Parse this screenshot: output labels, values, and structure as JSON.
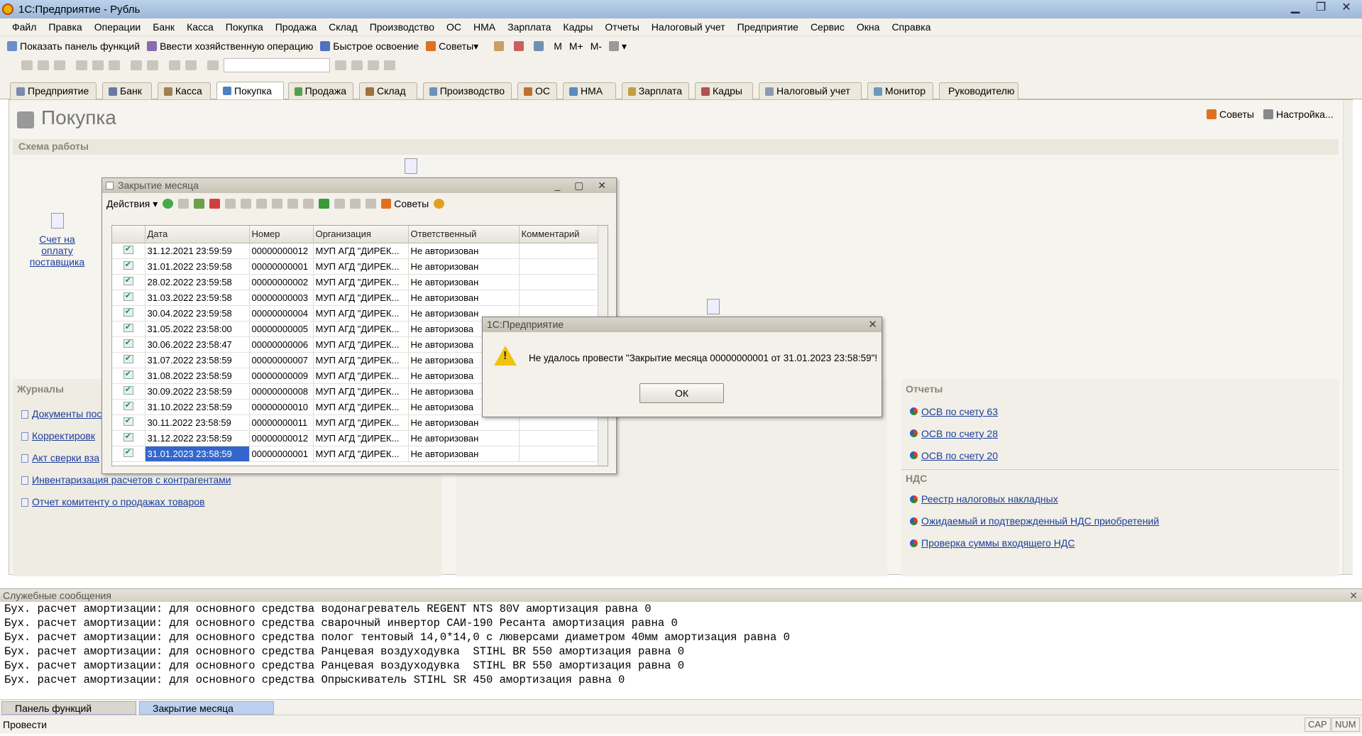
{
  "window": {
    "title": "1С:Предприятие - Рубль"
  },
  "menu": [
    "Файл",
    "Правка",
    "Операции",
    "Банк",
    "Касса",
    "Покупка",
    "Продажа",
    "Склад",
    "Производство",
    "ОС",
    "НМА",
    "Зарплата",
    "Кадры",
    "Отчеты",
    "Налоговый учет",
    "Предприятие",
    "Сервис",
    "Окна",
    "Справка"
  ],
  "toolbar1": {
    "show_panel": "Показать панель функций",
    "enter_op": "Ввести хозяйственную операцию",
    "quick": "Быстрое освоение",
    "tips": "Советы",
    "m": "М",
    "mplus": "М+",
    "mminus": "М-"
  },
  "tabs": [
    "Предприятие",
    "Банк",
    "Касса",
    "Покупка",
    "Продажа",
    "Склад",
    "Производство",
    "ОС",
    "НМА",
    "Зарплата",
    "Кадры",
    "Налоговый учет",
    "Монитор",
    "Руководителю"
  ],
  "page": {
    "title": "Покупка",
    "tips": "Советы",
    "settings": "Настройка...",
    "schema": "Схема работы",
    "invoice_link": "Счет на оплату поставщика"
  },
  "journals": {
    "header": "Журналы",
    "items": [
      "Документы пос",
      "Корректировк",
      "Акт сверки вза",
      "Инвентаризация расчетов с контрагентами",
      "Отчет комитенту о продажах товаров"
    ]
  },
  "reports": {
    "header": "Отчеты",
    "items": [
      "ОСВ по счету 63",
      "ОСВ по счету 28",
      "ОСВ по счету 20"
    ]
  },
  "vat": {
    "header": "НДС",
    "items": [
      "Реестр налоговых накладных",
      "Ожидаемый и подтвержденный НДС приобретений",
      "Проверка суммы входящего НДС"
    ]
  },
  "closing": {
    "title": "Закрытие месяца",
    "actions": "Действия",
    "tips": "Советы",
    "columns": [
      "Дата",
      "Номер",
      "Организация",
      "Ответственный",
      "Комментарий"
    ],
    "rows": [
      [
        "31.12.2021 23:59:59",
        "00000000012",
        "МУП АГД \"ДИРЕК...",
        "Не авторизован",
        ""
      ],
      [
        "31.01.2022 23:59:58",
        "00000000001",
        "МУП АГД \"ДИРЕК...",
        "Не авторизован",
        ""
      ],
      [
        "28.02.2022 23:59:58",
        "00000000002",
        "МУП АГД \"ДИРЕК...",
        "Не авторизован",
        ""
      ],
      [
        "31.03.2022 23:59:58",
        "00000000003",
        "МУП АГД \"ДИРЕК...",
        "Не авторизован",
        ""
      ],
      [
        "30.04.2022 23:59:58",
        "00000000004",
        "МУП АГД \"ДИРЕК...",
        "Не авторизован",
        ""
      ],
      [
        "31.05.2022 23:58:00",
        "00000000005",
        "МУП АГД \"ДИРЕК...",
        "Не авторизова",
        ""
      ],
      [
        "30.06.2022 23:58:47",
        "00000000006",
        "МУП АГД \"ДИРЕК...",
        "Не авторизова",
        ""
      ],
      [
        "31.07.2022 23:58:59",
        "00000000007",
        "МУП АГД \"ДИРЕК...",
        "Не авторизова",
        ""
      ],
      [
        "31.08.2022 23:58:59",
        "00000000009",
        "МУП АГД \"ДИРЕК...",
        "Не авторизова",
        ""
      ],
      [
        "30.09.2022 23:58:59",
        "00000000008",
        "МУП АГД \"ДИРЕК...",
        "Не авторизова",
        ""
      ],
      [
        "31.10.2022 23:58:59",
        "00000000010",
        "МУП АГД \"ДИРЕК...",
        "Не авторизова",
        ""
      ],
      [
        "30.11.2022 23:58:59",
        "00000000011",
        "МУП АГД \"ДИРЕК...",
        "Не авторизован",
        ""
      ],
      [
        "31.12.2022 23:58:59",
        "00000000012",
        "МУП АГД \"ДИРЕК...",
        "Не авторизован",
        ""
      ],
      [
        "31.01.2023 23:58:59",
        "00000000001",
        "МУП АГД \"ДИРЕК...",
        "Не авторизован",
        ""
      ]
    ]
  },
  "dialog": {
    "title": "1С:Предприятие",
    "message": "Не удалось провести \"Закрытие месяца 00000000001 от 31.01.2023 23:58:59\"!",
    "ok": "ОК"
  },
  "messages": {
    "header": "Служебные сообщения",
    "lines": [
      "Бух. расчет амортизации: для основного средства водонагреватель REGENT NTS 80V амортизация равна 0",
      "Бух. расчет амортизации: для основного средства сварочный инвертор САИ-190 Ресанта амортизация равна 0",
      "Бух. расчет амортизации: для основного средства полог тентовый 14,0*14,0 с люверсами диаметром 40мм амортизация равна 0",
      "Бух. расчет амортизации: для основного средства Ранцевая воздуходувка  STIHL BR 550 амортизация равна 0",
      "Бух. расчет амортизации: для основного средства Ранцевая воздуходувка  STIHL BR 550 амортизация равна 0",
      "Бух. расчет амортизации: для основного средства Опрыскиватель STIHL SR 450 амортизация равна 0"
    ]
  },
  "taskbar": [
    "Панель функций",
    "Закрытие месяца"
  ],
  "status": {
    "text": "Провести",
    "cap": "CAP",
    "num": "NUM"
  }
}
